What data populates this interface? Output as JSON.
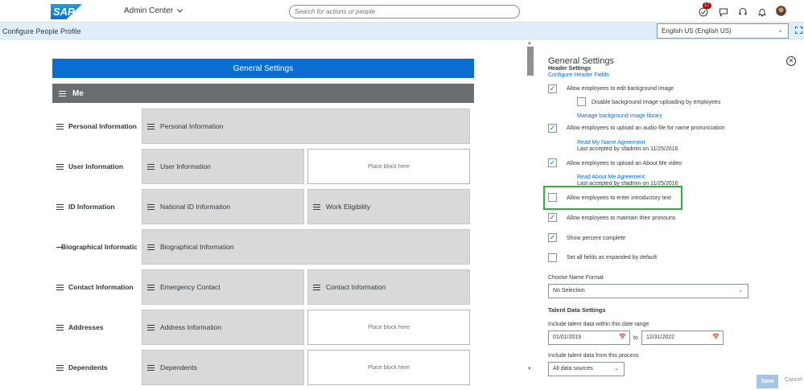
{
  "header": {
    "logo_text": "SAP",
    "app_title": "Admin Center",
    "search_placeholder": "Search for actions or people",
    "notification_count": "17"
  },
  "subheader": {
    "page_title": "Configure People Profile",
    "language": "English US (English US)"
  },
  "left": {
    "general_settings": "General Settings",
    "me_label": "Me",
    "rows": [
      {
        "label": "Personal Information",
        "blocks": [
          "Personal Information"
        ],
        "placeholder": null
      },
      {
        "label": "User Information",
        "blocks": [
          "User Information"
        ],
        "placeholder": "Place block here"
      },
      {
        "label": "ID Information",
        "blocks": [
          "National ID Information",
          "Work Eligibility"
        ],
        "placeholder": null
      },
      {
        "label": "Biographical Information",
        "blocks": [
          "Biographical Information"
        ],
        "placeholder": null
      },
      {
        "label": "Contact Information",
        "blocks": [
          "Emergency Contact",
          "Contact Information"
        ],
        "placeholder": null
      },
      {
        "label": "Addresses",
        "blocks": [
          "Address Information"
        ],
        "placeholder": "Place block here"
      },
      {
        "label": "Dependents",
        "blocks": [
          "Dependents"
        ],
        "placeholder": "Place block here"
      }
    ]
  },
  "panel": {
    "title": "General Settings",
    "subtitle": "Header Settings",
    "configure_link": "Configure Header Fields",
    "opt_bg_image": "Allow employees to edit background image",
    "opt_disable_bg": "Disable background image uploading by employees",
    "manage_bg_link": "Manage background image library",
    "opt_audio": "Allow employees to upload an audio file for name pronunciation",
    "read_name_link": "Read My Name Agreement",
    "name_accepted": "Last accepted by sfadmin on 11/25/2016",
    "opt_video": "Allow employees to upload an About Me video",
    "read_about_link": "Read About Me Agreement",
    "about_accepted": "Last accepted by sfadmin on 11/25/2016",
    "opt_intro": "Allow employees to enter introductory text",
    "opt_pronouns": "Allow employees to maintain their pronouns",
    "opt_percent": "Show percent complete",
    "opt_expand": "Set all fields as expanded by default",
    "name_format_label": "Choose Name Format",
    "name_format_value": "No Selection",
    "talent_heading": "Talent Data Settings",
    "date_range_label": "Include talent data within this date range",
    "date_from": "01/01/2019",
    "date_to_word": "to",
    "date_to": "12/31/2022",
    "process_label": "Include talent data from this process",
    "process_value": "All data sources",
    "save": "Save",
    "cancel": "Cancel"
  },
  "icons": {
    "check": "✓",
    "calendar": "📅",
    "close": "✕",
    "chevron": "⌄"
  },
  "checks": {
    "bg_image": true,
    "disable_bg": false,
    "audio": true,
    "video": true,
    "intro": false,
    "pronouns": true,
    "percent": true,
    "expand": false
  }
}
